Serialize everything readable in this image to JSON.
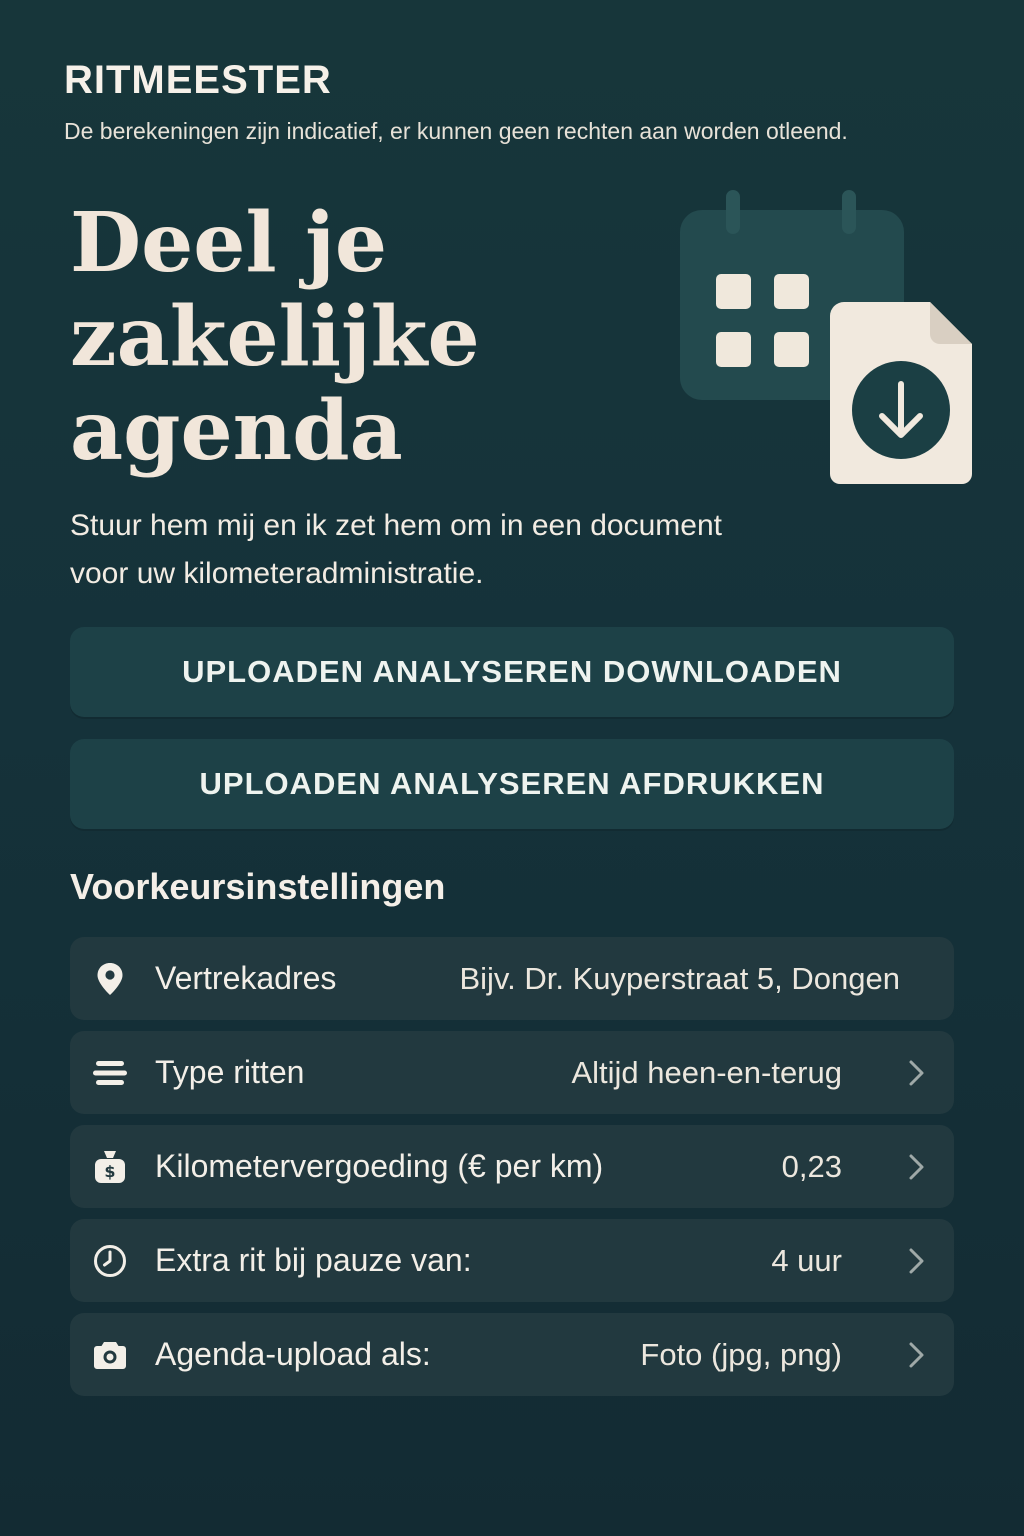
{
  "header": {
    "app_name": "RITMEESTER",
    "disclaimer": "De berekeningen zijn indicatief, er kunnen geen rechten aan worden otleend."
  },
  "hero": {
    "title": "Deel je zakelijke agenda",
    "subtitle": "Stuur hem mij en ik zet hem om in een document voor uw kilometeradministratie.",
    "illustration_icons": [
      "calendar-icon",
      "document-download-icon"
    ]
  },
  "actions": {
    "download_label": "UPLOADEN ANALYSEREN DOWNLOADEN",
    "print_label": "UPLOADEN ANALYSEREN AFDRUKKEN"
  },
  "settings": {
    "title": "Voorkeursinstellingen",
    "items": [
      {
        "icon": "location-pin-icon",
        "label": "Vertrekadres",
        "value": "",
        "placeholder": "Bijv. Dr. Kuyperstraat 5, Dongen"
      },
      {
        "icon": "route-lines-icon",
        "label": "Type ritten",
        "value": "Altijd heen-en-terug"
      },
      {
        "icon": "money-bag-icon",
        "label": "Kilometervergoeding (€ per km)",
        "value": "0,23"
      },
      {
        "icon": "clock-icon",
        "label": "Extra rit bij pauze van:",
        "value": "4 uur"
      },
      {
        "icon": "camera-icon",
        "label": "Agenda-upload als:",
        "value": "Foto (jpg, png)"
      }
    ]
  },
  "colors": {
    "background": "#17363a",
    "button": "#1d4147",
    "row": "#22393f",
    "text_light": "#f4ece1"
  }
}
